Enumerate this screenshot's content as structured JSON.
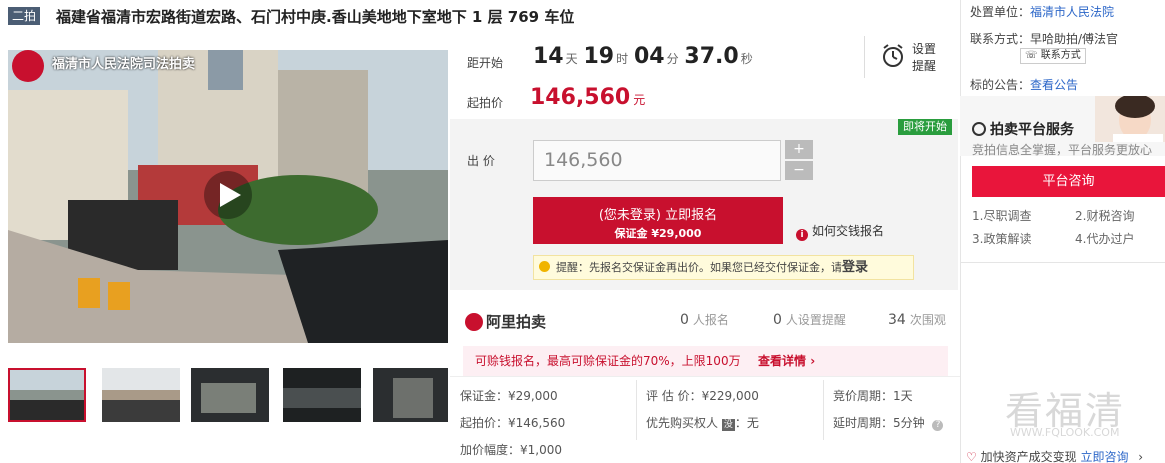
{
  "header": {
    "round_badge": "二拍",
    "title": "福建省福清市宏路街道宏路、石门村中庚.香山美地地下室地下 1 层 769 车位"
  },
  "media": {
    "watermark_text": "福清市人民法院司法拍卖",
    "thumbnails": [
      "thumb-1",
      "thumb-2",
      "thumb-3",
      "thumb-4",
      "thumb-5"
    ]
  },
  "countdown": {
    "label": "距开始",
    "days": "14",
    "days_unit": "天",
    "hours": "19",
    "hours_unit": "时",
    "minutes": "04",
    "minutes_unit": "分",
    "seconds": "37.0",
    "seconds_unit": "秒"
  },
  "reminder": {
    "line1": "设置",
    "line2": "提醒"
  },
  "start_price": {
    "label": "起拍价",
    "value": "146,560",
    "unit": "元"
  },
  "bid": {
    "status_badge": "即将开始",
    "label": "出 价",
    "input_value": "146,560",
    "plus": "+",
    "minus": "−",
    "signup_line1": "(您未登录) 立即报名",
    "signup_line2": "保证金 ¥29,000",
    "howto": "如何交钱报名",
    "tip_text": "提醒：先报名交保证金再出价。如果您已经交付保证金，请",
    "tip_login": "登录"
  },
  "stats": {
    "brand": "阿里拍卖",
    "signups": "0",
    "signups_label": "人报名",
    "reminders": "0",
    "reminders_label": "人设置提醒",
    "views": "34",
    "views_label": "次围观"
  },
  "promo": {
    "text": "可赊钱报名，最高可赊保证金的70%，上限100万",
    "more": "查看详情"
  },
  "details": {
    "deposit": "保证金：¥29,000",
    "appraisal": "评 估 价：¥229,000",
    "cycle": "竞价周期：1天",
    "start": "起拍价：¥146,560",
    "priority_label": "优先购买权人",
    "priority_badge": "没",
    "priority_value": "：无",
    "extend": "延时周期：5分钟",
    "increment": "加价幅度：¥1,000"
  },
  "sidebar": {
    "court_label": "处置单位：",
    "court_value": "福清市人民法院",
    "contact_label": "联系方式：",
    "contact_value": "早哈助拍/傅法官",
    "contact_button": "联系方式",
    "notice_label": "标的公告：",
    "notice_link": "查看公告",
    "service_title": "拍卖平台服务",
    "service_sub": "竞拍信息全掌握，平台服务更放心",
    "consult_button": "平台咨询",
    "services": [
      "1.尽职调查",
      "2.财税咨询",
      "3.政策解读",
      "4.代办过户"
    ],
    "bottom_text": "加快资产成交变现",
    "bottom_link": "立即咨询",
    "watermark": "看福清",
    "watermark_url": "WWW.FQLOOK.COM"
  },
  "colors": {
    "accent": "#c8102e",
    "link": "#2b66c8",
    "consult": "#e9153b",
    "badge": "#4b5d74"
  }
}
